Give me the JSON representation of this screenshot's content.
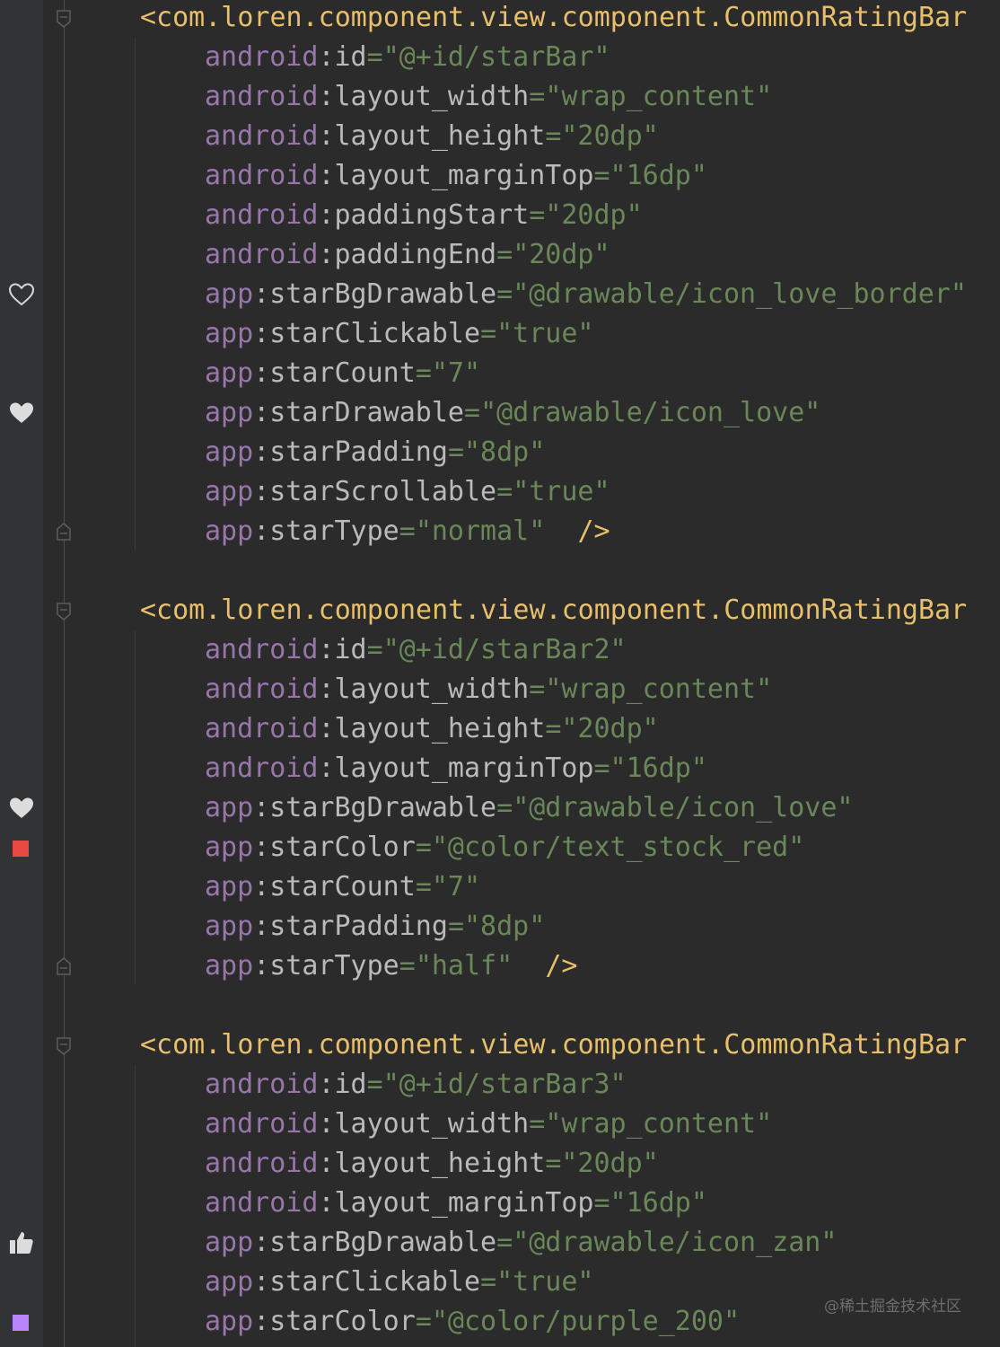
{
  "editor": {
    "language": "xml",
    "colors": {
      "background": "#2b2b2b",
      "gutter": "#313335",
      "tag": "#e8bf6a",
      "namespace": "#9876aa",
      "attribute": "#bababa",
      "value": "#6a8759",
      "red_swatch": "#e84a3f",
      "purple_swatch": "#bb86fc"
    },
    "gutter_icons": [
      {
        "name": "heart-outline-icon"
      },
      {
        "name": "heart-filled-icon"
      },
      {
        "name": "heart-filled-icon"
      },
      {
        "name": "red-color-swatch"
      },
      {
        "name": "thumbs-up-icon"
      },
      {
        "name": "purple-color-swatch"
      }
    ],
    "blocks": [
      {
        "tag": "<com.loren.component.view.component.CommonRatingBar",
        "attributes": [
          {
            "ns": "android",
            "name": "id",
            "value": "\"@+id/starBar\""
          },
          {
            "ns": "android",
            "name": "layout_width",
            "value": "\"wrap_content\""
          },
          {
            "ns": "android",
            "name": "layout_height",
            "value": "\"20dp\""
          },
          {
            "ns": "android",
            "name": "layout_marginTop",
            "value": "\"16dp\""
          },
          {
            "ns": "android",
            "name": "paddingStart",
            "value": "\"20dp\""
          },
          {
            "ns": "android",
            "name": "paddingEnd",
            "value": "\"20dp\""
          },
          {
            "ns": "app",
            "name": "starBgDrawable",
            "value": "\"@drawable/icon_love_border\""
          },
          {
            "ns": "app",
            "name": "starClickable",
            "value": "\"true\""
          },
          {
            "ns": "app",
            "name": "starCount",
            "value": "\"7\""
          },
          {
            "ns": "app",
            "name": "starDrawable",
            "value": "\"@drawable/icon_love\""
          },
          {
            "ns": "app",
            "name": "starPadding",
            "value": "\"8dp\""
          },
          {
            "ns": "app",
            "name": "starScrollable",
            "value": "\"true\""
          },
          {
            "ns": "app",
            "name": "starType",
            "value": "\"normal\"",
            "close": "/>"
          }
        ]
      },
      {
        "tag": "<com.loren.component.view.component.CommonRatingBar",
        "attributes": [
          {
            "ns": "android",
            "name": "id",
            "value": "\"@+id/starBar2\""
          },
          {
            "ns": "android",
            "name": "layout_width",
            "value": "\"wrap_content\""
          },
          {
            "ns": "android",
            "name": "layout_height",
            "value": "\"20dp\""
          },
          {
            "ns": "android",
            "name": "layout_marginTop",
            "value": "\"16dp\""
          },
          {
            "ns": "app",
            "name": "starBgDrawable",
            "value": "\"@drawable/icon_love\""
          },
          {
            "ns": "app",
            "name": "starColor",
            "value": "\"@color/text_stock_red\""
          },
          {
            "ns": "app",
            "name": "starCount",
            "value": "\"7\""
          },
          {
            "ns": "app",
            "name": "starPadding",
            "value": "\"8dp\""
          },
          {
            "ns": "app",
            "name": "starType",
            "value": "\"half\"",
            "close": "/>"
          }
        ]
      },
      {
        "tag": "<com.loren.component.view.component.CommonRatingBar",
        "attributes": [
          {
            "ns": "android",
            "name": "id",
            "value": "\"@+id/starBar3\""
          },
          {
            "ns": "android",
            "name": "layout_width",
            "value": "\"wrap_content\""
          },
          {
            "ns": "android",
            "name": "layout_height",
            "value": "\"20dp\""
          },
          {
            "ns": "android",
            "name": "layout_marginTop",
            "value": "\"16dp\""
          },
          {
            "ns": "app",
            "name": "starBgDrawable",
            "value": "\"@drawable/icon_zan\""
          },
          {
            "ns": "app",
            "name": "starClickable",
            "value": "\"true\""
          },
          {
            "ns": "app",
            "name": "starColor",
            "value": "\"@color/purple_200\""
          }
        ]
      }
    ]
  },
  "watermark": "@稀土掘金技术社区"
}
